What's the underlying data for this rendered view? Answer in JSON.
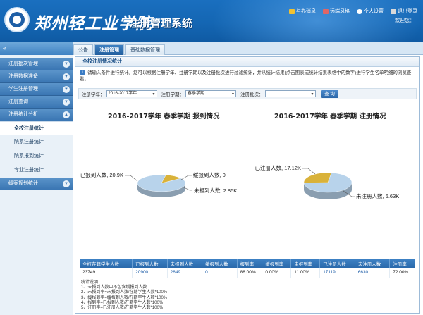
{
  "header": {
    "school_name": "郑州轻工业学院",
    "system_name": "注册管理系统",
    "links": [
      "与办消息",
      "远端风格",
      "个人设置",
      "退出登录"
    ],
    "welcome": "欢迎您：",
    "colors": {
      "msg": "#f1c232",
      "style": "#e06666",
      "user": "#ffffff",
      "logout": "#d9d9d9"
    }
  },
  "navbar": {
    "collapse": "«",
    "tabs": [
      "公告",
      "注册管理",
      "基础数据管理"
    ]
  },
  "sidebar": {
    "items_top": [
      "注册批次管理",
      "注册数据准备",
      "学生注册管理",
      "注册查询",
      "注册统计分析"
    ],
    "subitems": [
      "全校注册统计",
      "院系注册统计",
      "院系报到统计",
      "专业注册统计"
    ],
    "items_bottom": [
      "缓案规划统计"
    ]
  },
  "panel": {
    "title": "全校注册情况统计",
    "info": "请输入条件进行统计。您可以根据注册学年、注册学期以及注册批次进行过滤统计，并从统计结果(点击图表或统计结果表格中的数字)进行学生名单明细的浏览查看。"
  },
  "filters": {
    "year_label": "注册学年：",
    "year_value": "2016-2017学年",
    "term_label": "注册学期：",
    "term_value": "春季学期",
    "batch_label": "注册批次：",
    "batch_value": "",
    "query_button": "查 询"
  },
  "chart_data": [
    {
      "type": "pie",
      "title": "2016-2017学年 春季学期 报到情况",
      "slices": [
        {
          "label": "已报到人数",
          "value": 20900,
          "display": "20.9K",
          "color": "#b8d3eb"
        },
        {
          "label": "未报到人数",
          "value": 2849,
          "display": "2.85K",
          "color": "#d9b23a"
        },
        {
          "label": "缓报到人数",
          "value": 0,
          "display": "0",
          "color": "#777777"
        }
      ]
    },
    {
      "type": "pie",
      "title": "2016-2017学年 春季学期 注册情况",
      "slices": [
        {
          "label": "已注册人数",
          "value": 17119,
          "display": "17.12K",
          "color": "#b8d3eb"
        },
        {
          "label": "未注册人数",
          "value": 6630,
          "display": "6.63K",
          "color": "#d9b23a"
        }
      ]
    }
  ],
  "table": {
    "headers": [
      "全校在籍学生人数",
      "已报到人数",
      "未报到人数",
      "缓报到人数",
      "报到率",
      "缓报到率",
      "未报到率",
      "已注册人数",
      "未注册人数",
      "注册率"
    ],
    "row": [
      "23749",
      "20900",
      "2849",
      "0",
      "88.00%",
      "0.00%",
      "11.00%",
      "17119",
      "6630",
      "72.00%"
    ]
  },
  "notes": {
    "title": "统计说明",
    "lines": [
      "1、未报到人数中不包含缓报到人数",
      "2、未报到率=未报到人数/在籍学生人数*100%",
      "3、缓报到率=缓报到人数/在籍学生人数*100%",
      "4、报到率=已报到人数/在籍学生人数*100%",
      "5、注册率=已注册人数/在籍学生人数*100%"
    ]
  }
}
